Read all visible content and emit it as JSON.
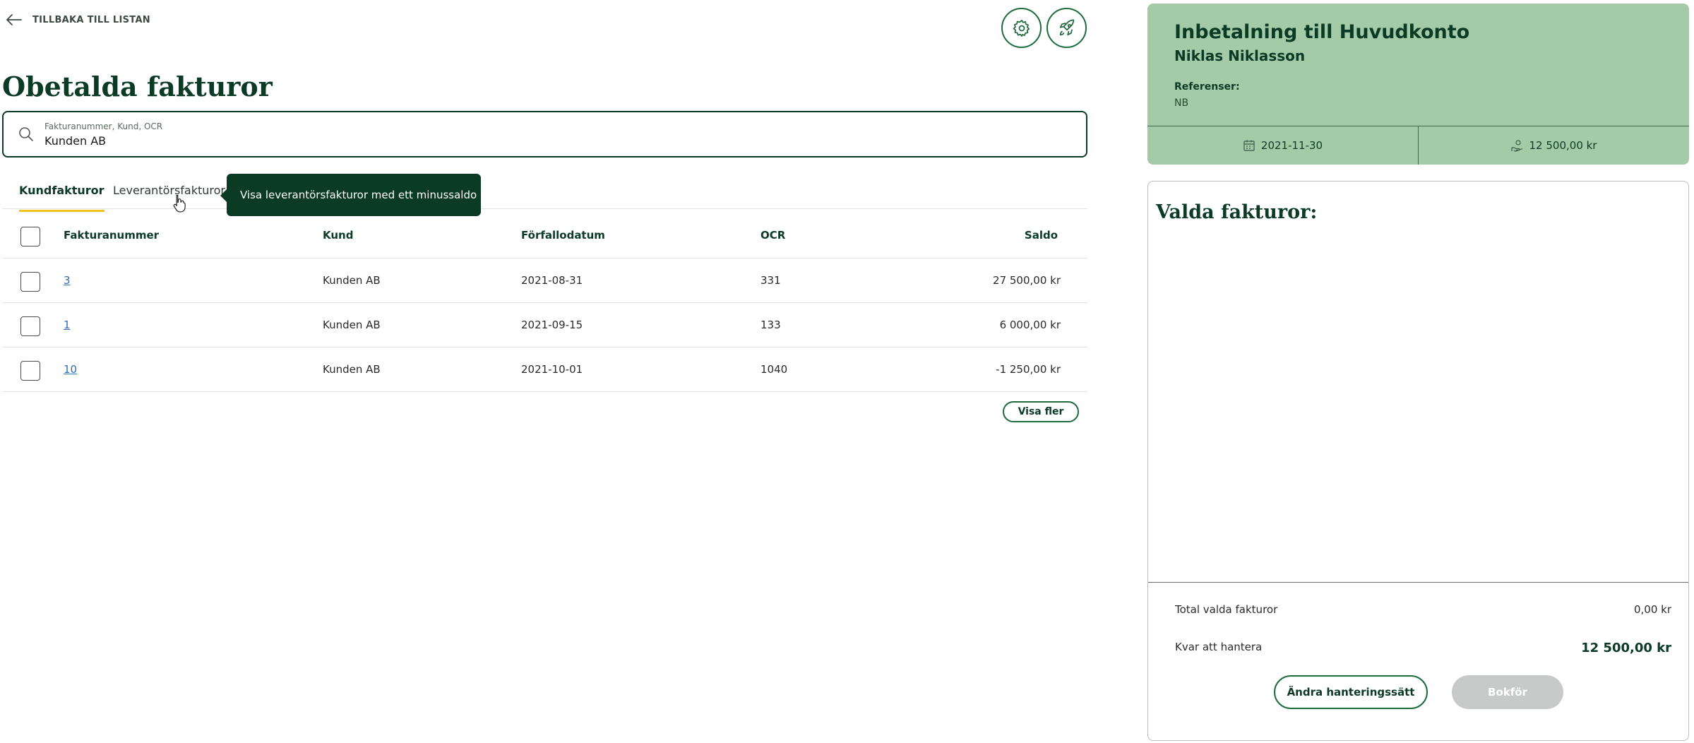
{
  "nav": {
    "back_label": "TILLBAKA TILL LISTAN"
  },
  "page": {
    "title": "Obetalda fakturor"
  },
  "search": {
    "placeholder": "Fakturanummer, Kund, OCR",
    "value": "Kunden AB"
  },
  "tabs": [
    {
      "label": "Kundfakturor",
      "active": true
    },
    {
      "label": "Leverantörsfakturor",
      "active": false
    }
  ],
  "tooltip": {
    "text": "Visa leverantörsfakturor med ett minussaldo"
  },
  "table": {
    "columns": [
      "Fakturanummer",
      "Kund",
      "Förfallodatum",
      "OCR",
      "Saldo"
    ],
    "rows": [
      {
        "number": "3",
        "customer": "Kunden AB",
        "due": "2021-08-31",
        "ocr": "331",
        "balance": "27 500,00 kr"
      },
      {
        "number": "1",
        "customer": "Kunden AB",
        "due": "2021-09-15",
        "ocr": "133",
        "balance": "6 000,00 kr"
      },
      {
        "number": "10",
        "customer": "Kunden AB",
        "due": "2021-10-01",
        "ocr": "1040",
        "balance": "-1 250,00 kr"
      }
    ],
    "show_more_label": "Visa fler"
  },
  "payment": {
    "title": "Inbetalning till Huvudkonto",
    "payer": "Niklas Niklasson",
    "references_label": "Referenser:",
    "references_value": "NB",
    "date": "2021-11-30",
    "amount": "12 500,00 kr"
  },
  "selected": {
    "title": "Valda fakturor:",
    "total_label": "Total valda fakturor",
    "total_value": "0,00 kr",
    "remaining_label": "Kvar att hantera",
    "remaining_value": "12 500,00 kr",
    "change_method_label": "Ändra hanteringssätt",
    "book_label": "Bokför"
  },
  "icons": {
    "back": "arrow-left-icon",
    "settings": "gear-icon",
    "rocket": "rocket-icon",
    "search": "search-icon",
    "calendar": "calendar-icon",
    "money": "money-hand-icon"
  },
  "colors": {
    "brand_dark": "#0b3a25",
    "brand_green": "#1e6b3c",
    "payment_bg": "#a3cba8",
    "tab_indicator": "#f0c419",
    "link": "#2f6fb3",
    "disabled_button": "#c7cac8"
  }
}
